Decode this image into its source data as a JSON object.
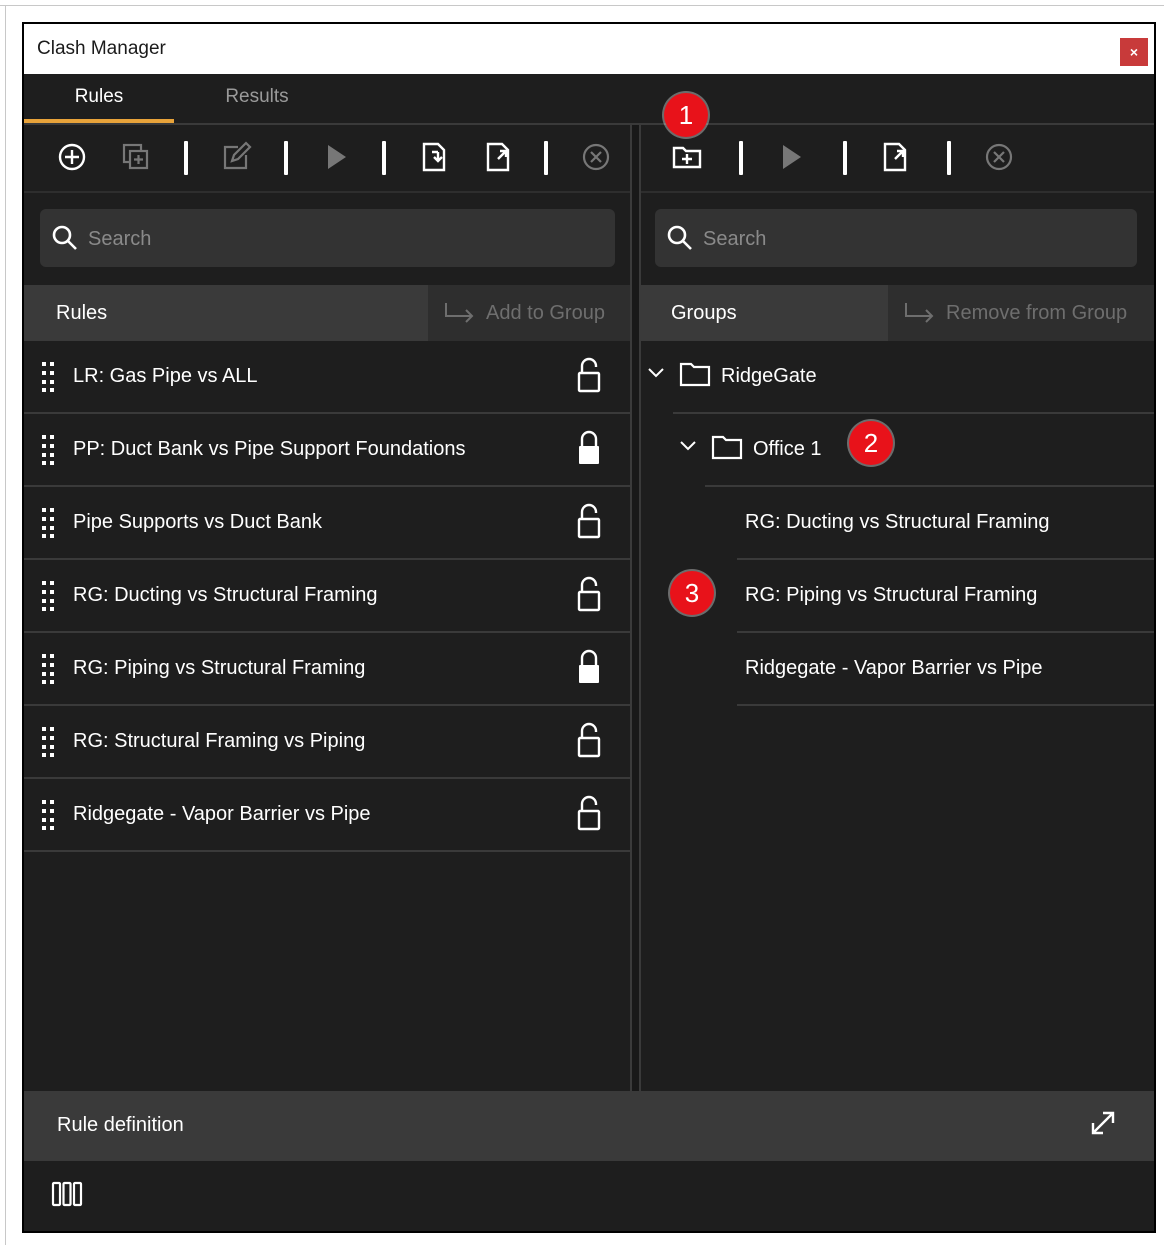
{
  "window": {
    "title": "Clash Manager",
    "close_label": "×"
  },
  "tabs": [
    {
      "label": "Rules",
      "active": true
    },
    {
      "label": "Results",
      "active": false
    }
  ],
  "left_pane": {
    "toolbar_icons": [
      "add-circle-icon",
      "duplicate-icon",
      "edit-icon",
      "run-icon",
      "import-icon",
      "export-icon",
      "cancel-circle-icon"
    ],
    "search": {
      "placeholder": "Search",
      "value": ""
    },
    "list_title": "Rules",
    "add_to_group_label": "Add to Group",
    "rules": [
      {
        "label": "LR: Gas Pipe vs ALL",
        "locked": false
      },
      {
        "label": "PP: Duct Bank vs Pipe Support Foundations",
        "locked": true
      },
      {
        "label": "Pipe Supports vs Duct Bank",
        "locked": false
      },
      {
        "label": "RG: Ducting vs Structural Framing",
        "locked": false
      },
      {
        "label": "RG: Piping vs Structural Framing",
        "locked": true
      },
      {
        "label": "RG: Structural Framing vs Piping",
        "locked": false
      },
      {
        "label": "Ridgegate - Vapor Barrier vs Pipe",
        "locked": false
      }
    ]
  },
  "right_pane": {
    "toolbar_icons": [
      "new-folder-icon",
      "run-icon",
      "export-icon",
      "cancel-circle-icon"
    ],
    "search": {
      "placeholder": "Search",
      "value": ""
    },
    "list_title": "Groups",
    "remove_from_group_label": "Remove from Group",
    "tree": [
      {
        "label": "RidgeGate",
        "type": "folder",
        "level": 0,
        "expanded": true
      },
      {
        "label": "Office 1",
        "type": "folder",
        "level": 1,
        "expanded": true
      },
      {
        "label": "RG: Ducting vs Structural Framing",
        "type": "rule",
        "level": 2
      },
      {
        "label": "RG: Piping vs Structural Framing",
        "type": "rule",
        "level": 2
      },
      {
        "label": "Ridgegate - Vapor Barrier vs Pipe",
        "type": "rule",
        "level": 2
      }
    ]
  },
  "callouts": [
    "1",
    "2",
    "3"
  ],
  "rule_definition": {
    "title": "Rule definition"
  },
  "colors": {
    "background": "#1e1e1e",
    "header": "#3a3a3a",
    "accent_tab": "#e8a33a",
    "callout": "#e8121a",
    "close": "#c83a3a"
  }
}
